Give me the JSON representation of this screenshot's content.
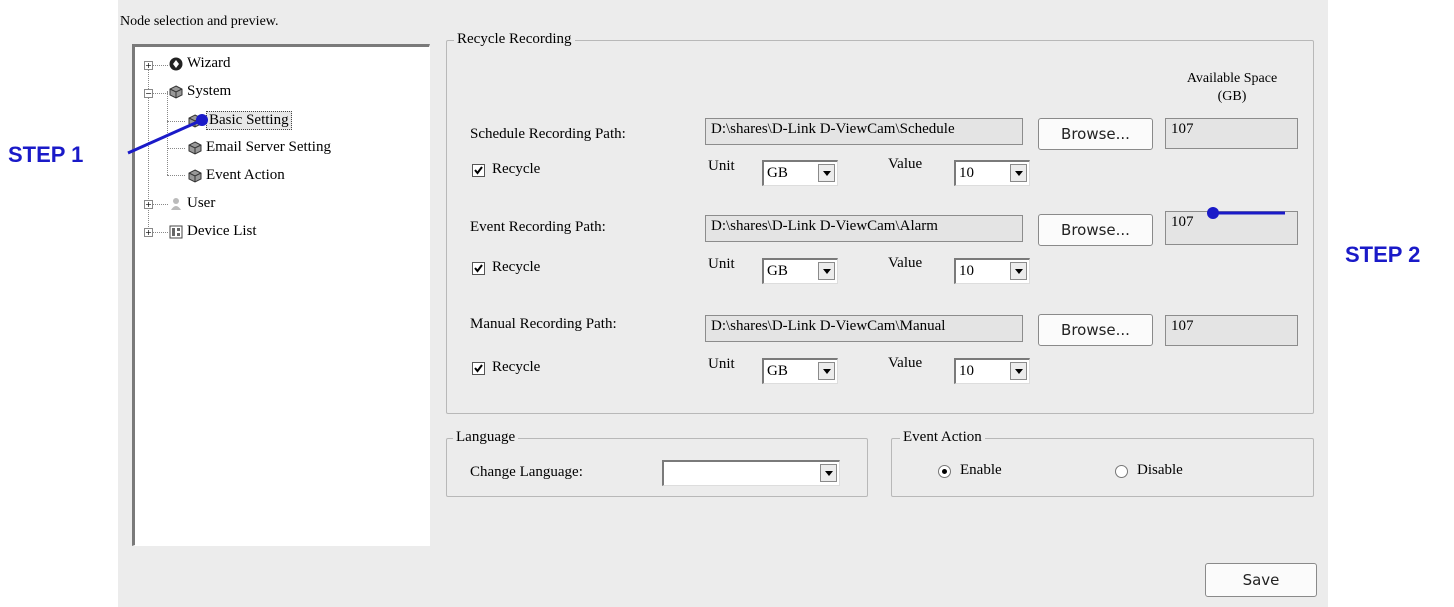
{
  "header": {
    "caption": "Node selection and preview."
  },
  "tree": {
    "items": [
      {
        "label": "Wizard",
        "icon": "wizard-icon"
      },
      {
        "label": "System",
        "icon": "cube-icon"
      },
      {
        "label": "Basic Setting",
        "icon": "cube-icon"
      },
      {
        "label": "Email Server Setting",
        "icon": "cube-icon"
      },
      {
        "label": "Event Action",
        "icon": "cube-icon"
      },
      {
        "label": "User",
        "icon": "user-icon"
      },
      {
        "label": "Device List",
        "icon": "device-list-icon"
      }
    ]
  },
  "recycle": {
    "title": "Recycle Recording",
    "available_space_label": "Available Space\n(GB)",
    "browse_label": "Browse...",
    "recycle_label": "Recycle",
    "unit_label": "Unit",
    "value_label": "Value",
    "rows": [
      {
        "label": "Schedule Recording Path:",
        "path": "D:\\shares\\D-Link D-ViewCam\\Schedule",
        "space": "107",
        "unit": "GB",
        "value": "10"
      },
      {
        "label": "Event Recording Path:",
        "path": "D:\\shares\\D-Link D-ViewCam\\Alarm",
        "space": "107",
        "unit": "GB",
        "value": "10"
      },
      {
        "label": "Manual Recording Path:",
        "path": "D:\\shares\\D-Link D-ViewCam\\Manual",
        "space": "107",
        "unit": "GB",
        "value": "10"
      }
    ]
  },
  "language": {
    "title": "Language",
    "change_label": "Change Language:",
    "selected": ""
  },
  "event_action": {
    "title": "Event Action",
    "enable_label": "Enable",
    "disable_label": "Disable",
    "selected": "Enable"
  },
  "save_label": "Save",
  "annotations": {
    "step1": "STEP 1",
    "step2": "STEP 2"
  },
  "colors": {
    "annotation": "#1a1ac8",
    "dialog_bg": "#ececec"
  }
}
